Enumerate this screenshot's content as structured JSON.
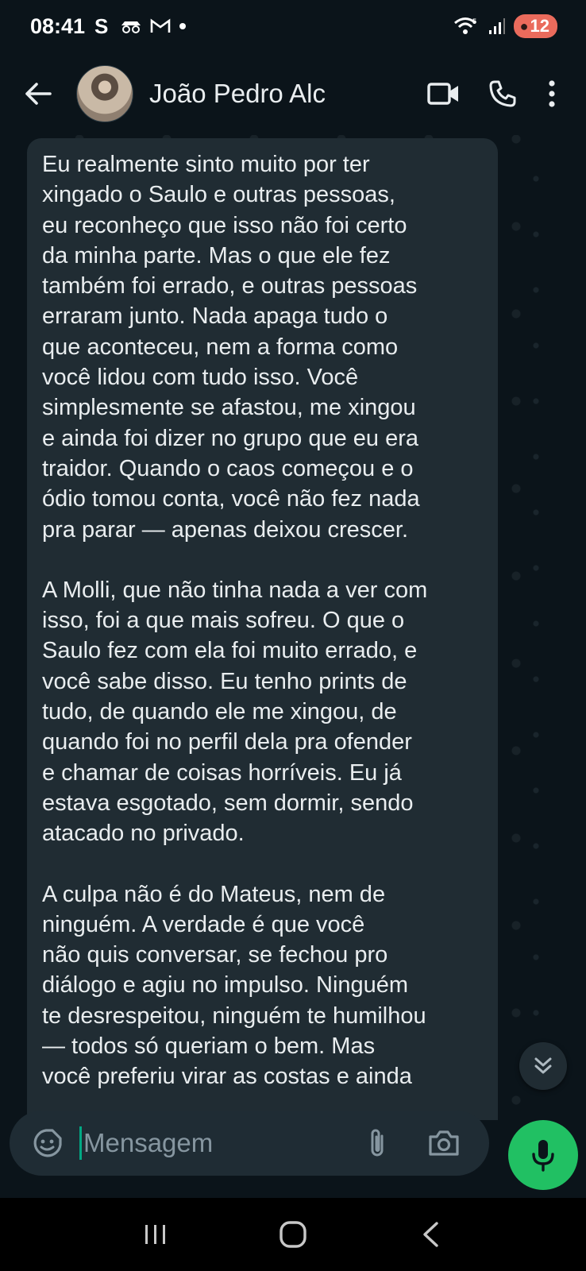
{
  "status_bar": {
    "time": "08:41",
    "left_icons": [
      "skype-icon",
      "incognito-icon",
      "gmail-icon",
      "dot-icon"
    ],
    "battery": "12"
  },
  "header": {
    "contact_name": "João Pedro Alc",
    "icons": [
      "back-arrow-icon",
      "video-call-icon",
      "phone-icon",
      "more-vert-icon"
    ]
  },
  "message": {
    "paragraphs": [
      "Eu realmente sinto muito por ter\nxingado o Saulo e outras pessoas,\neu reconheço que isso não foi certo\nda minha parte. Mas o que ele fez\ntambém foi errado, e outras pessoas\nerraram junto. Nada apaga tudo o\nque aconteceu, nem a forma como\nvocê lidou com tudo isso. Você\nsimplesmente se afastou, me xingou\ne ainda foi dizer no grupo que eu era\ntraidor. Quando o caos começou e o\nódio tomou conta, você não fez nada\npra parar — apenas deixou crescer.",
      "A Molli, que não tinha nada a ver com\nisso, foi a que mais sofreu. O que o\nSaulo fez com ela foi muito errado, e\nvocê sabe disso. Eu tenho prints de\ntudo, de quando ele me xingou, de\nquando foi no perfil dela pra ofender\ne chamar de coisas horríveis. Eu já\nestava esgotado, sem dormir, sendo\natacado no privado.",
      "A culpa não é do Mateus, nem de\nninguém. A verdade é que você\nnão quis conversar, se fechou pro\ndiálogo e agiu no impulso. Ninguém\nte desrespeitou, ninguém te humilhou\n— todos só queriam o bem. Mas\nvocê preferiu virar as costas e ainda"
    ]
  },
  "composer": {
    "placeholder": "Mensagem",
    "icons": [
      "emoji-icon",
      "attach-icon",
      "camera-icon",
      "mic-icon"
    ]
  },
  "colors": {
    "background": "#0b141a",
    "bubble": "#202c33",
    "accent_green": "#21c063",
    "battery_low": "#ea6b5c"
  }
}
